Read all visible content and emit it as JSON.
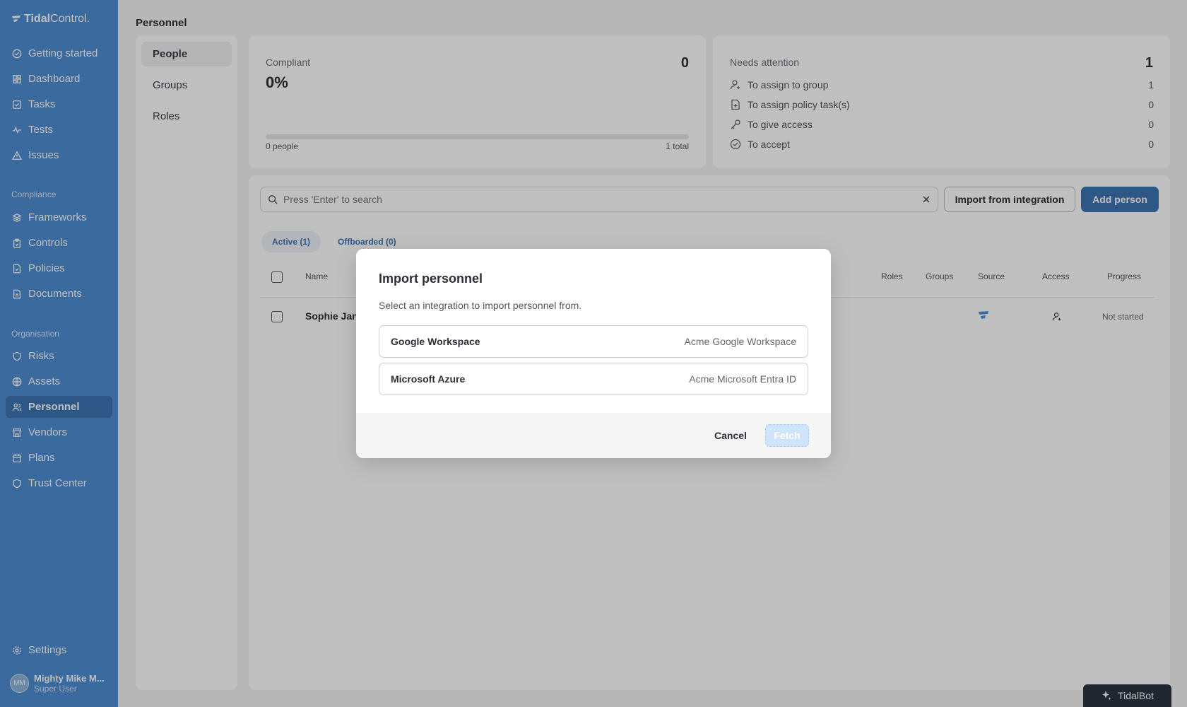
{
  "brand": {
    "part_a": "Tidal",
    "part_b": "Control."
  },
  "sidebar": {
    "items_top": [
      {
        "label": "Getting started",
        "icon": "check-circle-icon"
      },
      {
        "label": "Dashboard",
        "icon": "dashboard-icon"
      },
      {
        "label": "Tasks",
        "icon": "task-check-icon"
      },
      {
        "label": "Tests",
        "icon": "pulse-icon"
      },
      {
        "label": "Issues",
        "icon": "warning-triangle-icon"
      }
    ],
    "section_compliance": "Compliance",
    "items_compliance": [
      {
        "label": "Frameworks",
        "icon": "layers-icon"
      },
      {
        "label": "Controls",
        "icon": "clipboard-icon"
      },
      {
        "label": "Policies",
        "icon": "document-icon"
      },
      {
        "label": "Documents",
        "icon": "file-icon"
      }
    ],
    "section_organisation": "Organisation",
    "items_organisation": [
      {
        "label": "Risks",
        "icon": "shield-alert-icon"
      },
      {
        "label": "Assets",
        "icon": "globe-icon"
      },
      {
        "label": "Personnel",
        "icon": "users-icon",
        "active": true
      },
      {
        "label": "Vendors",
        "icon": "store-icon"
      },
      {
        "label": "Plans",
        "icon": "calendar-icon"
      },
      {
        "label": "Trust Center",
        "icon": "shield-icon"
      }
    ],
    "settings": "Settings",
    "user": {
      "initials": "MM",
      "name": "Mighty Mike M...",
      "role": "Super User"
    }
  },
  "page_title": "Personnel",
  "subnav": [
    "People",
    "Groups",
    "Roles"
  ],
  "compliant": {
    "label": "Compliant",
    "count": "0",
    "percent": "0%",
    "people": "0 people",
    "total": "1 total",
    "progress_fraction": 0
  },
  "needs_attention": {
    "label": "Needs attention",
    "count": "1",
    "rows": [
      {
        "label": "To assign to group",
        "value": "1",
        "icon": "user-plus-icon"
      },
      {
        "label": "To assign policy task(s)",
        "value": "0",
        "icon": "file-plus-icon"
      },
      {
        "label": "To give access",
        "value": "0",
        "icon": "key-icon"
      },
      {
        "label": "To accept",
        "value": "0",
        "icon": "check-circle-icon"
      }
    ]
  },
  "search": {
    "placeholder": "Press 'Enter' to search",
    "value": ""
  },
  "buttons": {
    "import": "Import from integration",
    "add": "Add person"
  },
  "tabs": {
    "active": "Active (1)",
    "offboarded": "Offboarded (0)"
  },
  "table": {
    "headers": {
      "name": "Name",
      "roles": "Roles",
      "groups": "Groups",
      "source": "Source",
      "access": "Access",
      "progress": "Progress"
    },
    "rows": [
      {
        "name": "Sophie Jan",
        "progress": "Not started"
      }
    ]
  },
  "tidalbot": "TidalBot",
  "modal": {
    "title": "Import personnel",
    "description": "Select an integration to import personnel from.",
    "integrations": [
      {
        "name": "Google Workspace",
        "detail": "Acme Google Workspace"
      },
      {
        "name": "Microsoft Azure",
        "detail": "Acme Microsoft Entra ID"
      }
    ],
    "cancel": "Cancel",
    "fetch": "Fetch"
  },
  "colors": {
    "sidebar": "#4f8ed3",
    "primary": "#3c74b4",
    "fetch_disabled": "#cfe4fb"
  }
}
